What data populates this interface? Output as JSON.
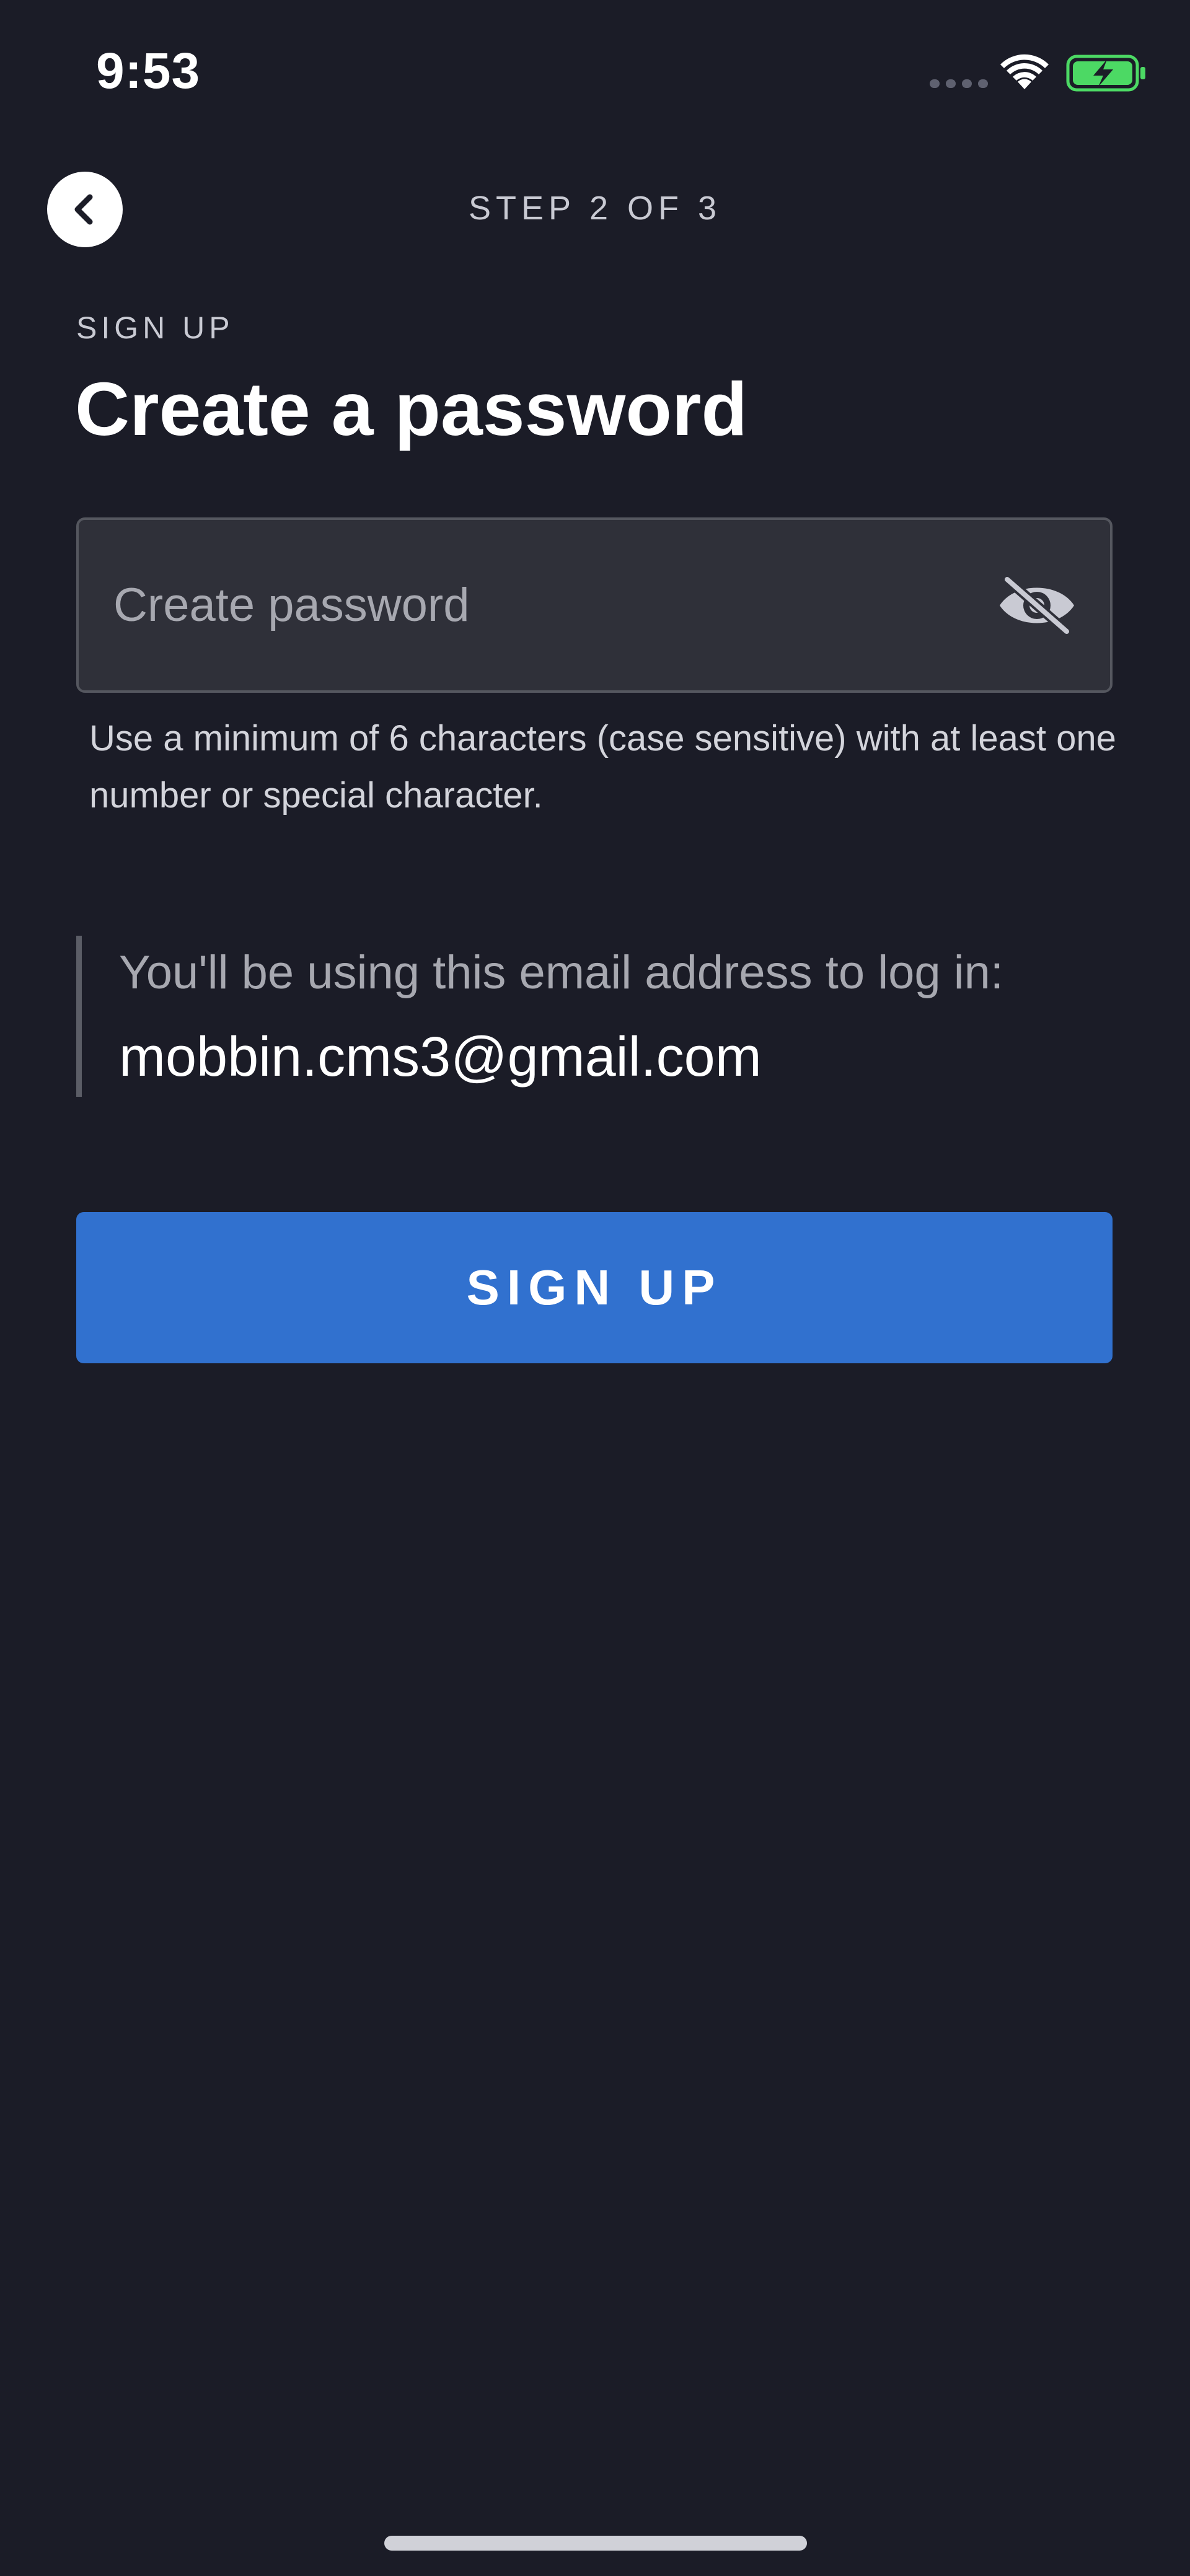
{
  "status_bar": {
    "time": "9:53",
    "wifi_icon": "wifi-icon",
    "battery_icon": "battery-charging-icon",
    "battery_color": "#4cd964"
  },
  "header": {
    "back_icon": "chevron-left-icon",
    "step": "STEP 2 OF 3"
  },
  "form": {
    "overline": "SIGN UP",
    "title": "Create a password",
    "password": {
      "placeholder": "Create password",
      "value": "",
      "toggle_icon": "eye-slash-icon"
    },
    "helper_text": "Use a minimum of 6 characters (case sensitive) with at least one number or special character."
  },
  "email_note": {
    "label": "You'll be using this email address to log in:",
    "email": "mobbin.cms3@gmail.com"
  },
  "actions": {
    "signup_label": "SIGN UP"
  },
  "colors": {
    "background": "#1b1c27",
    "field_background": "#2f3039",
    "primary": "#3171cf"
  }
}
